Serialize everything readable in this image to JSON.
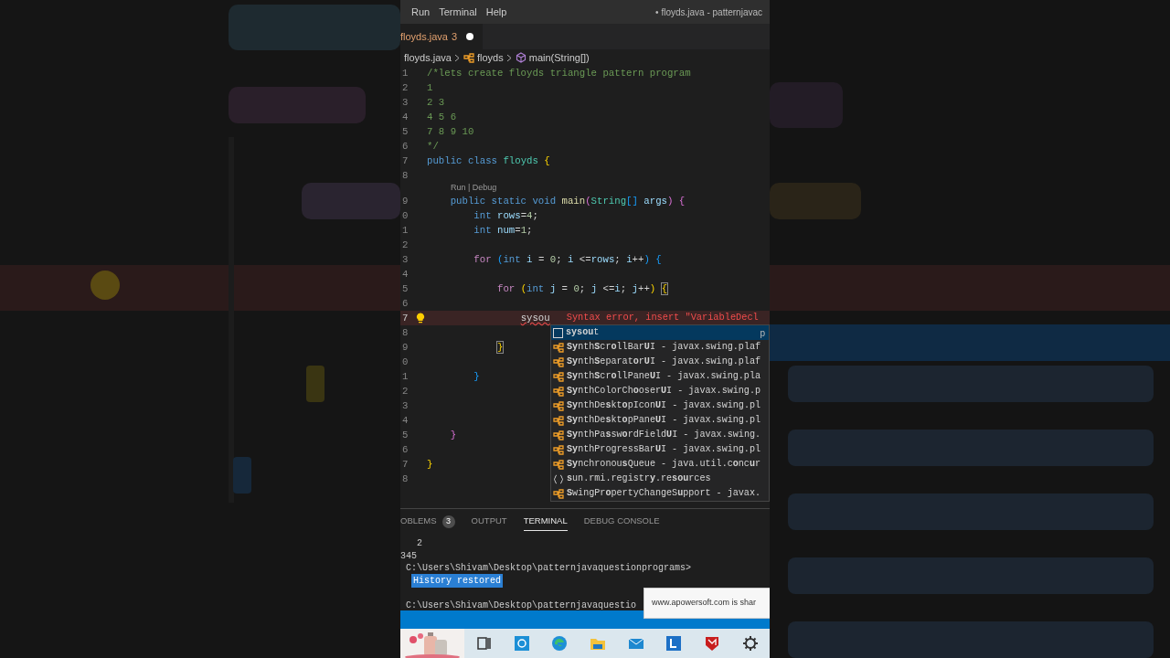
{
  "menu": [
    "Run",
    "Terminal",
    "Help"
  ],
  "window_title": "• floyds.java - patternjavac",
  "tabs": [
    {
      "label": "floyds.java",
      "problems": "3",
      "modified": true,
      "selected": true
    }
  ],
  "breadcrumb": [
    {
      "kind": "file",
      "label": "floyds.java"
    },
    {
      "kind": "class",
      "label": "floyds"
    },
    {
      "kind": "method",
      "label": "main(String[])"
    }
  ],
  "editor": {
    "lines": [
      {
        "kind": "code",
        "number": "1",
        "tokens": [
          {
            "kind": "comment",
            "text": "/*lets create floyds triangle pattern program"
          }
        ]
      },
      {
        "kind": "code",
        "number": "2",
        "tokens": [
          {
            "kind": "comment",
            "text": "1"
          }
        ]
      },
      {
        "kind": "code",
        "number": "3",
        "tokens": [
          {
            "kind": "comment",
            "text": "2 3"
          }
        ]
      },
      {
        "kind": "code",
        "number": "4",
        "tokens": [
          {
            "kind": "comment",
            "text": "4 5 6"
          }
        ]
      },
      {
        "kind": "code",
        "number": "5",
        "tokens": [
          {
            "kind": "comment",
            "text": "7 8 9 10"
          }
        ]
      },
      {
        "kind": "code",
        "number": "6",
        "tokens": [
          {
            "kind": "comment",
            "text": "*/"
          }
        ]
      },
      {
        "kind": "code",
        "number": "7",
        "tokens": [
          {
            "kind": "keyword",
            "text": "public class "
          },
          {
            "kind": "type",
            "text": "floyds "
          },
          {
            "kind": "bracket1",
            "text": "{"
          }
        ]
      },
      {
        "kind": "code",
        "number": "8"
      },
      {
        "kind": "codelens",
        "text": "Run | Debug"
      },
      {
        "kind": "code",
        "number": "9",
        "tokens": [
          {
            "kind": "keyword",
            "text": "    public static void "
          },
          {
            "kind": "function",
            "text": "main"
          },
          {
            "kind": "bracket2",
            "text": "("
          },
          {
            "kind": "type",
            "text": "String"
          },
          {
            "kind": "bracket3",
            "text": "[]"
          },
          {
            "kind": "variable",
            "text": " args"
          },
          {
            "kind": "bracket2",
            "text": ")"
          },
          {
            "kind": "bracket2",
            "text": " {"
          }
        ]
      },
      {
        "kind": "code",
        "number": "0",
        "tokens": [
          {
            "kind": "keyword",
            "text": "        int "
          },
          {
            "kind": "variable",
            "text": "rows"
          },
          {
            "kind": "plain",
            "text": "="
          },
          {
            "kind": "number",
            "text": "4"
          },
          {
            "kind": "plain",
            "text": ";"
          }
        ]
      },
      {
        "kind": "code",
        "number": "1",
        "tokens": [
          {
            "kind": "keyword",
            "text": "        int "
          },
          {
            "kind": "variable",
            "text": "num"
          },
          {
            "kind": "plain",
            "text": "="
          },
          {
            "kind": "number",
            "text": "1"
          },
          {
            "kind": "plain",
            "text": ";"
          }
        ]
      },
      {
        "kind": "code",
        "number": "2"
      },
      {
        "kind": "code",
        "number": "3",
        "tokens": [
          {
            "kind": "control",
            "text": "        for "
          },
          {
            "kind": "bracket3",
            "text": "("
          },
          {
            "kind": "keyword",
            "text": "int "
          },
          {
            "kind": "variable",
            "text": "i"
          },
          {
            "kind": "plain",
            "text": " = "
          },
          {
            "kind": "number",
            "text": "0"
          },
          {
            "kind": "plain",
            "text": "; "
          },
          {
            "kind": "variable",
            "text": "i"
          },
          {
            "kind": "plain",
            "text": " <="
          },
          {
            "kind": "variable",
            "text": "rows"
          },
          {
            "kind": "plain",
            "text": "; "
          },
          {
            "kind": "variable",
            "text": "i"
          },
          {
            "kind": "plain",
            "text": "++"
          },
          {
            "kind": "bracket3",
            "text": ")"
          },
          {
            "kind": "bracket3",
            "text": " {"
          }
        ]
      },
      {
        "kind": "code",
        "number": "4"
      },
      {
        "kind": "code",
        "number": "5",
        "tokens": [
          {
            "kind": "control",
            "text": "            for "
          },
          {
            "kind": "bracket1",
            "text": "("
          },
          {
            "kind": "keyword",
            "text": "int "
          },
          {
            "kind": "variable",
            "text": "j"
          },
          {
            "kind": "plain",
            "text": " = "
          },
          {
            "kind": "number",
            "text": "0"
          },
          {
            "kind": "plain",
            "text": "; "
          },
          {
            "kind": "variable",
            "text": "j"
          },
          {
            "kind": "plain",
            "text": " <="
          },
          {
            "kind": "variable",
            "text": "i"
          },
          {
            "kind": "plain",
            "text": "; "
          },
          {
            "kind": "variable",
            "text": "j"
          },
          {
            "kind": "plain",
            "text": "++"
          },
          {
            "kind": "bracket1",
            "text": ") "
          },
          {
            "kind": "match",
            "text": "{"
          }
        ]
      },
      {
        "kind": "code",
        "number": "6"
      },
      {
        "kind": "code",
        "number": "7",
        "current": true,
        "lightbulb": true,
        "diagnostic": "Syntax error, insert \"VariableDecl",
        "tokens": [
          {
            "kind": "error",
            "text": "                sysou"
          }
        ]
      },
      {
        "kind": "code",
        "number": "8"
      },
      {
        "kind": "code",
        "number": "9",
        "tokens": [
          {
            "kind": "match",
            "text": "            }"
          }
        ]
      },
      {
        "kind": "code",
        "number": "0"
      },
      {
        "kind": "code",
        "number": "1",
        "tokens": [
          {
            "kind": "bracket3",
            "text": "        }"
          }
        ]
      },
      {
        "kind": "code",
        "number": "2"
      },
      {
        "kind": "code",
        "number": "3"
      },
      {
        "kind": "code",
        "number": "4"
      },
      {
        "kind": "code",
        "number": "5",
        "tokens": [
          {
            "kind": "bracket2",
            "text": "    }"
          }
        ]
      },
      {
        "kind": "code",
        "number": "6"
      },
      {
        "kind": "code",
        "number": "7",
        "tokens": [
          {
            "kind": "bracket1",
            "text": "}"
          }
        ]
      },
      {
        "kind": "code",
        "number": "8"
      }
    ]
  },
  "suggestions": [
    {
      "kind": "snippet",
      "label": "**sysou**t",
      "detail": "p",
      "selected": true
    },
    {
      "kind": "class",
      "label": "**Sy**nth**S**cr**o**llBar**U**I - javax.swing.plaf",
      "selected": false
    },
    {
      "kind": "class",
      "label": "**Sy**nth**S**eparat**o**r**U**I - javax.swing.plaf",
      "selected": false
    },
    {
      "kind": "class",
      "label": "**Sy**nth**S**cr**o**llPane**U**I - javax.swing.pla",
      "selected": false
    },
    {
      "kind": "class",
      "label": "**Sy**nthColorCh**o**oser**U**I - javax.swing.p",
      "selected": false
    },
    {
      "kind": "class",
      "label": "**Sy**nthDe**s**kt**o**pIcon**U**I - javax.swing.pl",
      "selected": false
    },
    {
      "kind": "class",
      "label": "**Sy**nthDe**s**kt**o**pPane**U**I - javax.swing.pl",
      "selected": false
    },
    {
      "kind": "class",
      "label": "**Sy**nthPa**s**sw**o**rdField**U**I - javax.swing.",
      "selected": false
    },
    {
      "kind": "class",
      "label": "**Sy**nthProgressBar**U**I - javax.swing.pl",
      "selected": false
    },
    {
      "kind": "class",
      "label": "**Sy**nchronou**s**Queue - java.util.c**o**nc**u**r",
      "selected": false
    },
    {
      "kind": "module",
      "label": "**s**un.rmi.registr**y**.re**sou**rces",
      "selected": false
    },
    {
      "kind": "class",
      "label": "**S**wingPr**o**pertyChangeS**u**pport - javax.",
      "selected": false
    }
  ],
  "panel": {
    "tabs": [
      {
        "label": "OBLEMS",
        "badge": "3",
        "selected": false
      },
      {
        "label": "OUTPUT",
        "selected": false
      },
      {
        "label": "TERMINAL",
        "selected": true
      },
      {
        "label": "DEBUG CONSOLE",
        "selected": false
      }
    ],
    "terminal": [
      {
        "kind": "text",
        "text": "   2"
      },
      {
        "kind": "text",
        "text": "345"
      },
      {
        "kind": "text",
        "text": " C:\\Users\\Shivam\\Desktop\\patternjavaquestionprograms>"
      },
      {
        "kind": "highlight",
        "text": "History restored"
      },
      {
        "kind": "blank"
      },
      {
        "kind": "text",
        "text": " C:\\Users\\Shivam\\Desktop\\patternjavaquestio"
      }
    ]
  },
  "notification": "www.apowersoft.com is shar"
}
